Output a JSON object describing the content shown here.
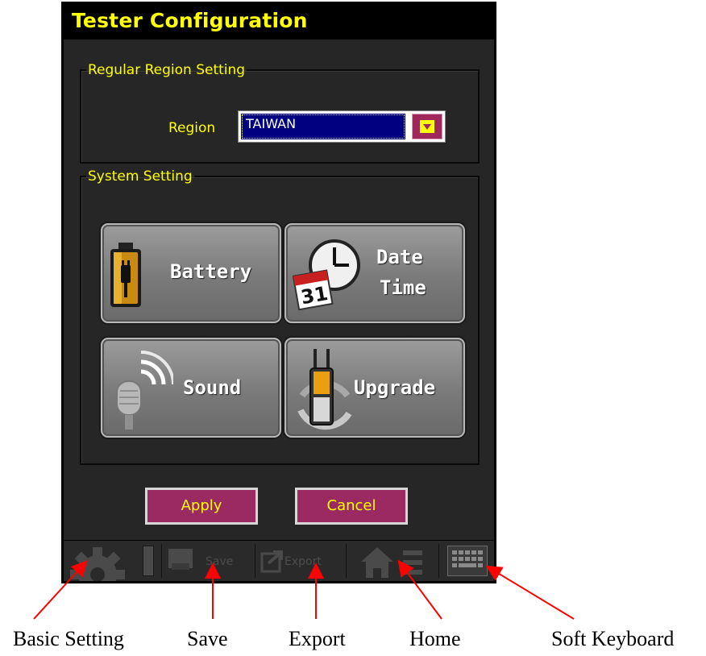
{
  "window": {
    "title": "Tester Configuration"
  },
  "region_group": {
    "legend": "Regular Region Setting",
    "region_label": "Region",
    "region_value": "TAIWAN"
  },
  "system_group": {
    "legend": "System Setting",
    "tiles": [
      {
        "label": "Battery",
        "icon": "battery-icon"
      },
      {
        "label_line1": "Date",
        "label_line2": "Time",
        "icon": "calendar-clock-icon",
        "calendar_text": "31"
      },
      {
        "label": "Sound",
        "icon": "microphone-icon"
      },
      {
        "label": "Upgrade",
        "icon": "tester-upgrade-icon"
      }
    ]
  },
  "buttons": {
    "apply": "Apply",
    "cancel": "Cancel"
  },
  "toolbar": {
    "save": "Save",
    "export": "Export",
    "icons": [
      "gear-icon",
      "save-icon",
      "export-icon",
      "home-icon",
      "menu-icon",
      "keyboard-icon"
    ]
  },
  "annotations": [
    "Basic Setting",
    "Save",
    "Export",
    "Home",
    "Soft Keyboard"
  ],
  "colors": {
    "accent_yellow": "#ffff00",
    "button_magenta": "#9c2a62",
    "select_blue": "#000080",
    "arrow_red": "#ff0000"
  }
}
